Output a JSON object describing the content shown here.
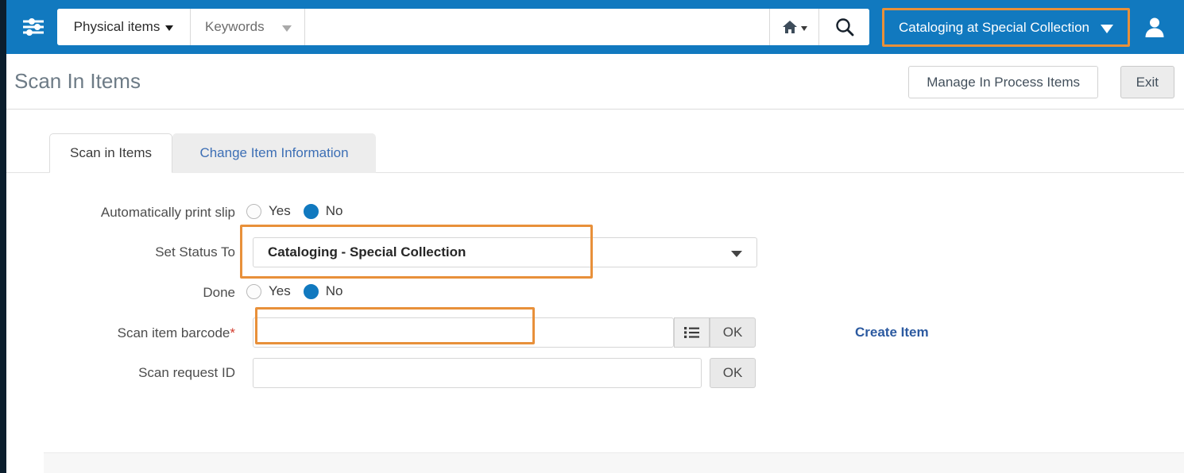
{
  "header": {
    "sliders_icon": "sliders-icon",
    "search_scope": "Physical items",
    "search_field_type": "Keywords",
    "search_value": "",
    "search_placeholder": "",
    "home_icon": "home-icon",
    "search_icon": "search-icon",
    "institution_scope": "Cataloging at Special Collection",
    "avatar_icon": "user-avatar-icon",
    "brand_blue": "#1179bf",
    "highlight_orange": "#e8903a"
  },
  "titlebar": {
    "title": "Scan In Items",
    "manage_button": "Manage In Process Items",
    "exit_button": "Exit"
  },
  "tabs": [
    {
      "label": "Scan in Items",
      "active": true
    },
    {
      "label": "Change Item Information",
      "active": false
    }
  ],
  "form": {
    "print_slip": {
      "label": "Automatically print slip",
      "options": [
        "Yes",
        "No"
      ],
      "selected": "No"
    },
    "set_status": {
      "label": "Set Status To",
      "value": "Cataloging - Special Collection",
      "highlighted": true
    },
    "done": {
      "label": "Done",
      "options": [
        "Yes",
        "No"
      ],
      "selected": "No"
    },
    "scan_barcode": {
      "label": "Scan item barcode",
      "required_marker": "*",
      "value": "",
      "placeholder": "",
      "list_icon": "list-icon",
      "ok_button": "OK",
      "highlighted": true
    },
    "scan_request": {
      "label": "Scan request ID",
      "value": "",
      "placeholder": "",
      "ok_button": "OK"
    },
    "create_item_link": "Create Item"
  }
}
